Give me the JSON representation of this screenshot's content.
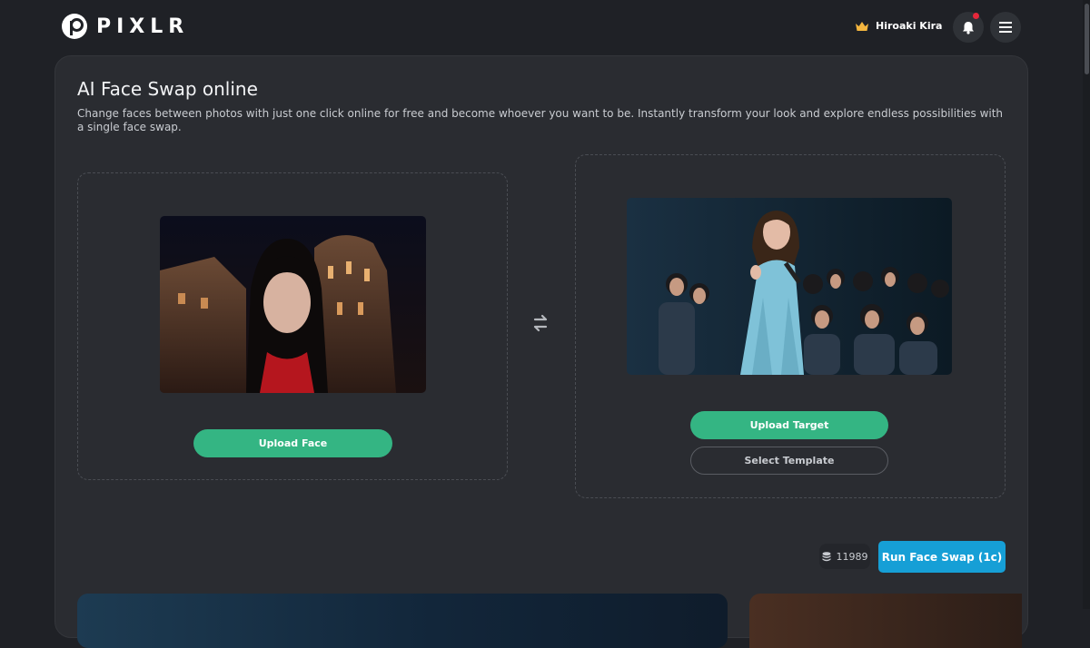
{
  "header": {
    "brand": "PIXLR",
    "user_name": "Hiroaki Kira"
  },
  "main": {
    "title": "AI Face Swap online",
    "description": "Change faces between photos with just one click online for free and become whoever you want to be. Instantly transform your look and explore endless possibilities with a single face swap."
  },
  "face_panel": {
    "upload_label": "Upload Face"
  },
  "target_panel": {
    "upload_label": "Upload Target",
    "template_label": "Select Template"
  },
  "footer": {
    "credits": "11989",
    "run_label": "Run Face Swap (1c)"
  },
  "colors": {
    "accent_green": "#34b583",
    "accent_blue": "#169fd6",
    "notification_dot": "#e5273a"
  }
}
